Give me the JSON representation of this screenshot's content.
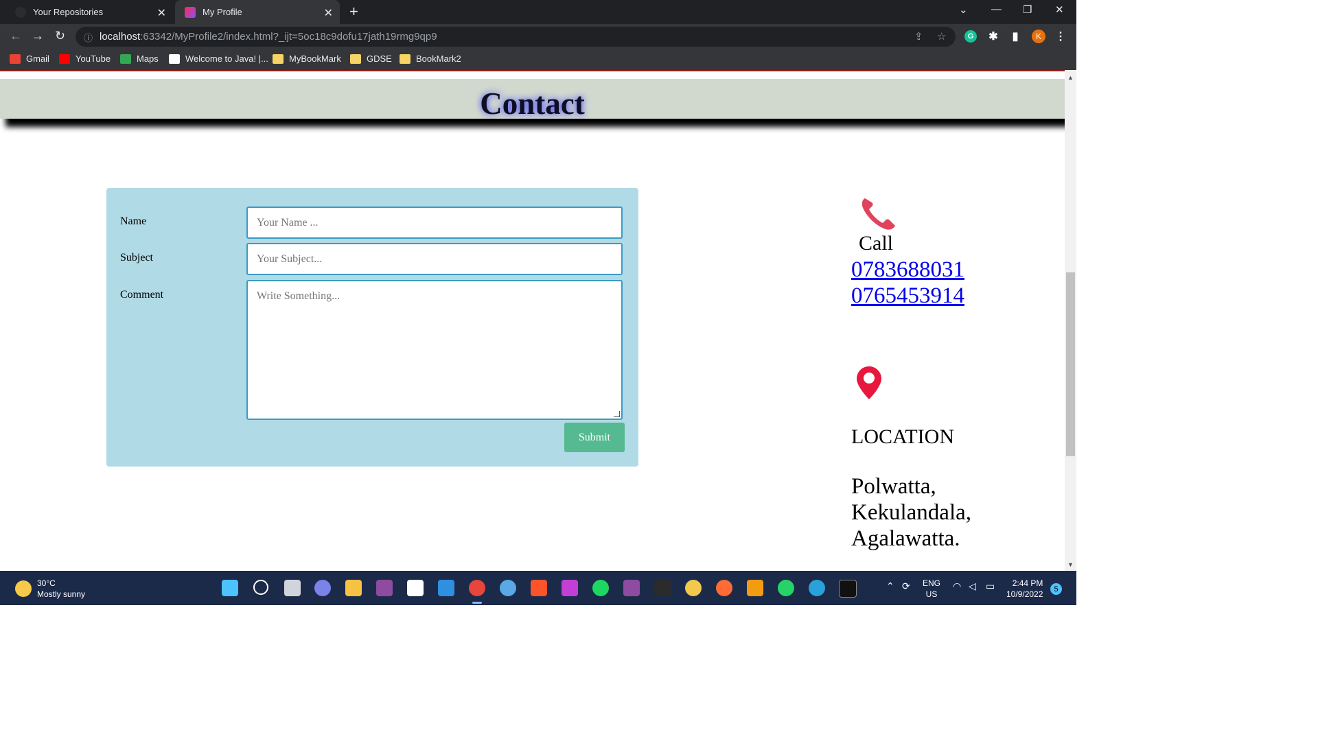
{
  "browser": {
    "tabs": [
      {
        "title": "Your Repositories"
      },
      {
        "title": "My Profile"
      }
    ],
    "address": {
      "host": "localhost",
      "path": ":63342/MyProfile2/index.html?_ijt=5oc18c9dofu17jath19rmg9qp9"
    },
    "profile_initial": "K",
    "bookmarks": [
      {
        "label": "Gmail",
        "color": "#ea4335"
      },
      {
        "label": "YouTube",
        "color": "#ff0000"
      },
      {
        "label": "Maps",
        "color": "#34a853"
      },
      {
        "label": "Welcome to Java! |...",
        "color": "#ffffff"
      },
      {
        "label": "MyBookMark",
        "color": "#f6d365"
      },
      {
        "label": "GDSE",
        "color": "#f6d365"
      },
      {
        "label": "BookMark2",
        "color": "#f6d365"
      }
    ]
  },
  "page": {
    "heading": "Contact",
    "form": {
      "name_label": "Name",
      "name_placeholder": "Your Name ...",
      "subject_label": "Subject",
      "subject_placeholder": "Your Subject...",
      "comment_label": "Comment",
      "comment_placeholder": "Write Something...",
      "submit_label": "Submit"
    },
    "contact": {
      "call_label": "Call",
      "phones": [
        "0783688031",
        "0765453914"
      ],
      "location_title": "LOCATION",
      "address_lines": [
        "Polwatta,",
        "Kekulandala,",
        "Agalawatta."
      ]
    }
  },
  "taskbar": {
    "temperature": "30°C",
    "weather": "Mostly sunny",
    "language": "ENG",
    "region": "US",
    "time": "2:44 PM",
    "date": "10/9/2022",
    "notifications": "5"
  }
}
